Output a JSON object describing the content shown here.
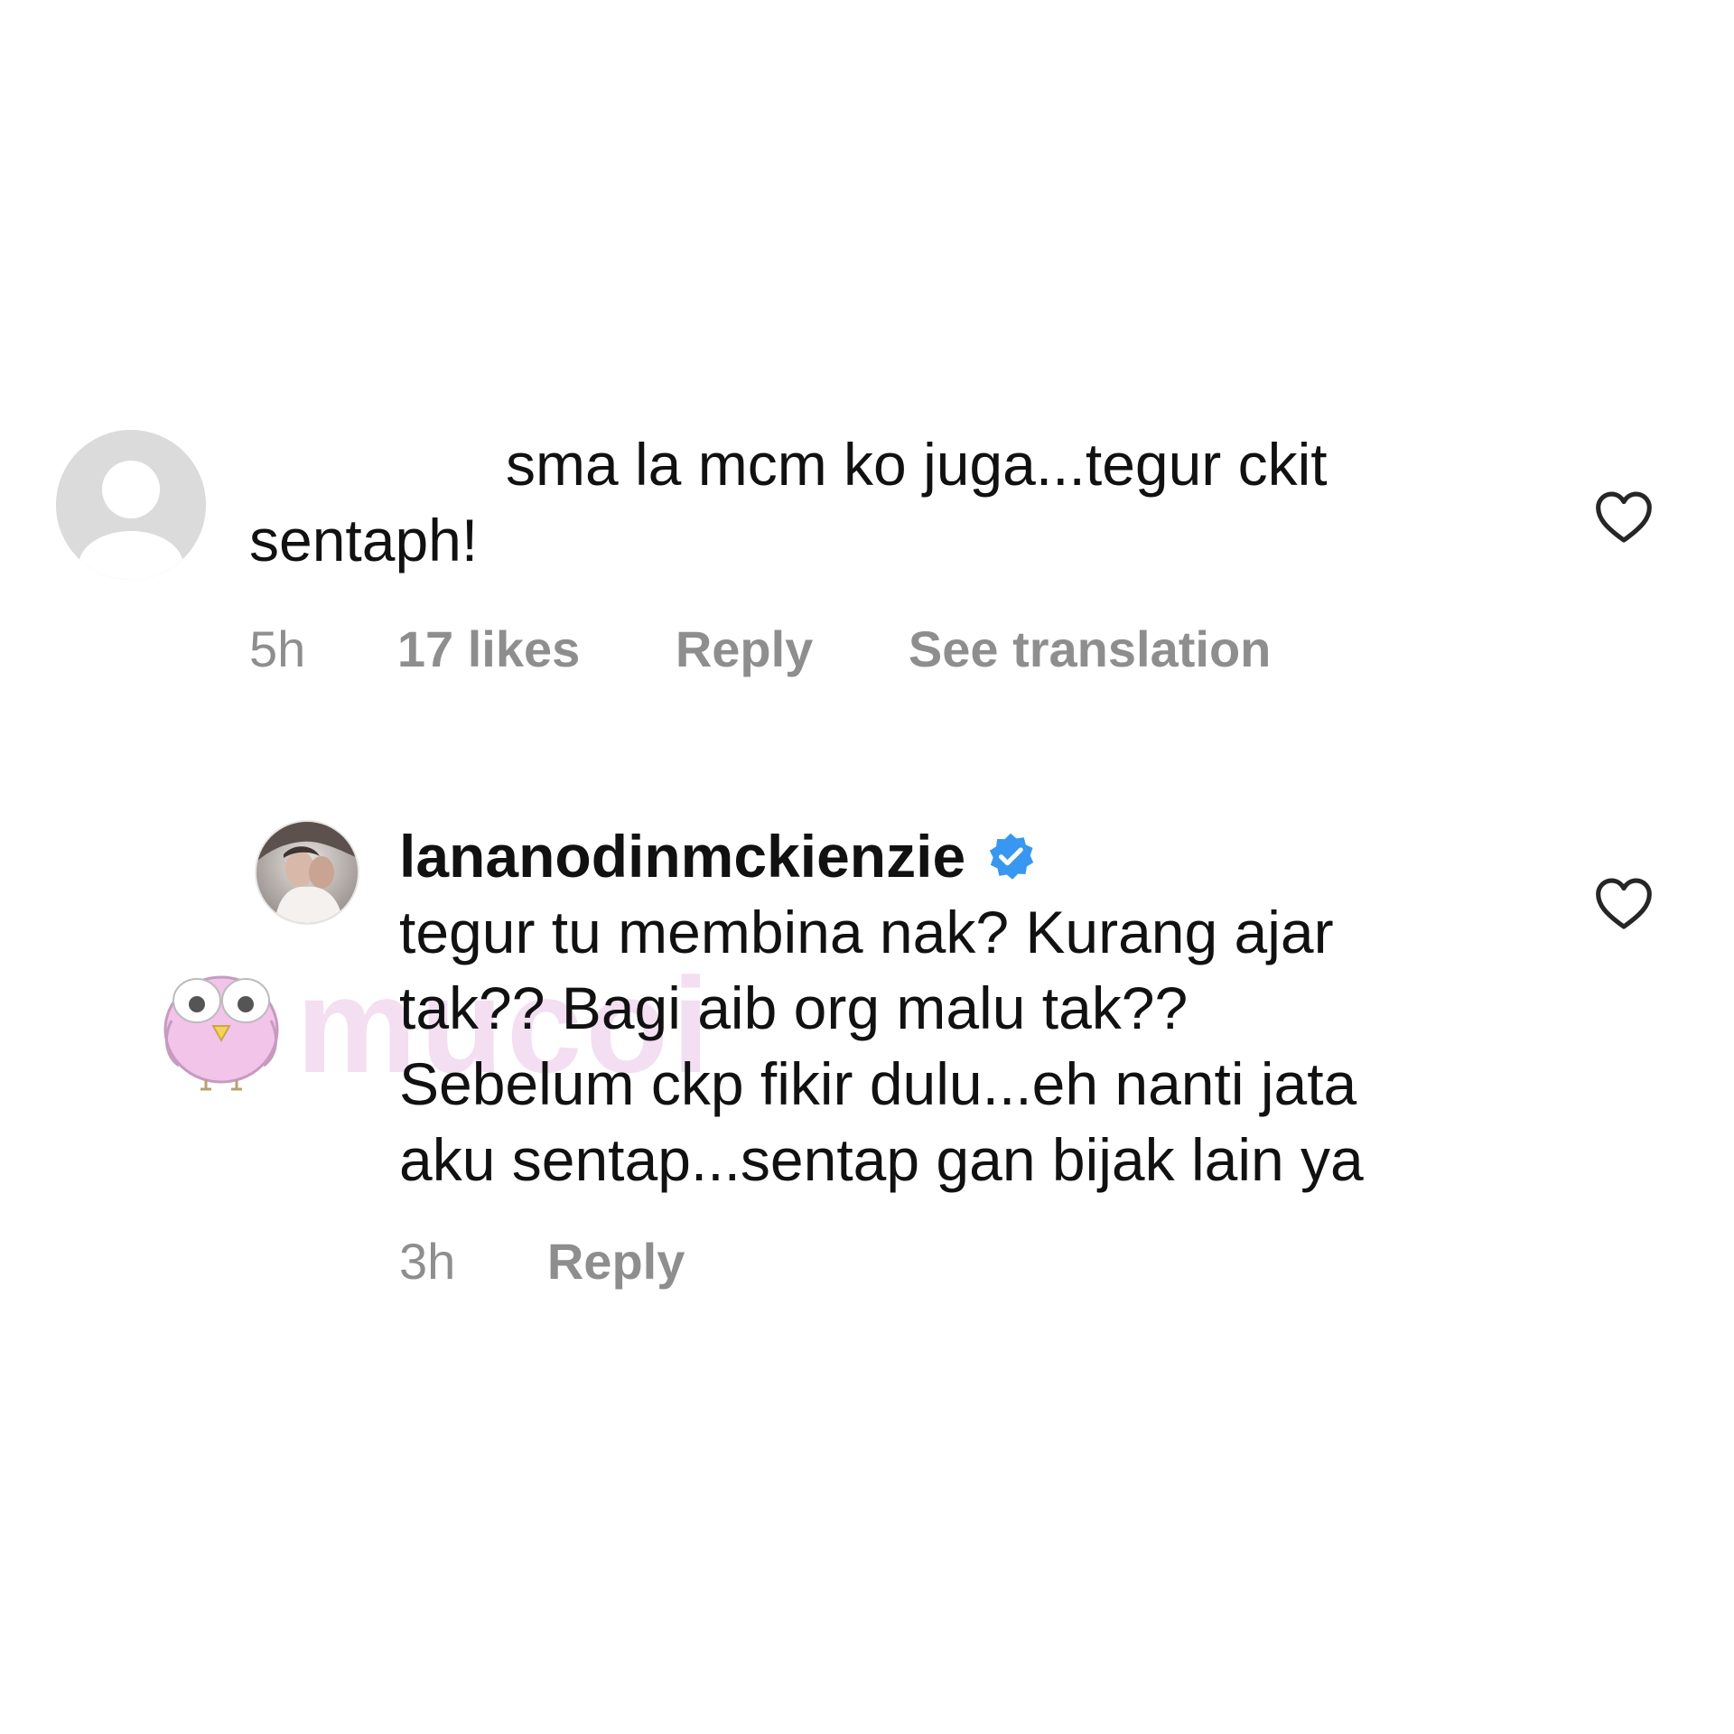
{
  "comments": [
    {
      "avatar": "default-avatar-icon",
      "text_line1": "sma la mcm ko juga...tegur ckit",
      "text_line2": "sentaph!",
      "time": "5h",
      "likes": "17 likes",
      "reply_label": "Reply",
      "translate_label": "See translation"
    },
    {
      "avatar": "profile-photo",
      "username": "lananodinmckienzie",
      "verified": true,
      "text_lines": [
        "tegur tu membina nak? Kurang ajar",
        "tak?? Bagi aib org malu tak??",
        "Sebelum ckp fikir dulu...eh nanti jata",
        "aku sentap...sentap gan bijak lain ya"
      ],
      "time": "3h",
      "reply_label": "Reply"
    }
  ],
  "watermark": {
    "text": "mucoi"
  },
  "colors": {
    "text": "#111111",
    "meta": "#8e8e8e",
    "verified": "#3897f0",
    "watermark": "#f0d4ee"
  }
}
